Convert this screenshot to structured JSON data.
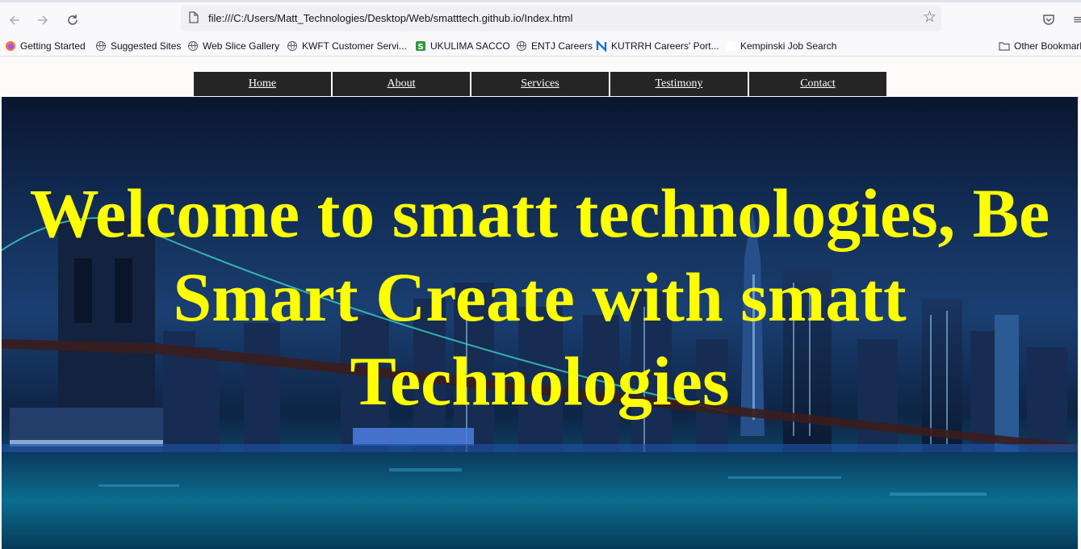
{
  "browser": {
    "url": "file:///C:/Users/Matt_Technologies/Desktop/Web/smatttech.github.io/Index.html",
    "bookmarks": [
      {
        "label": "Getting Started",
        "icon": "firefox-icon"
      },
      {
        "label": "Suggested Sites",
        "icon": "globe-icon"
      },
      {
        "label": "Web Slice Gallery",
        "icon": "globe-icon"
      },
      {
        "label": "KWFT Customer Servi...",
        "icon": "globe-icon"
      },
      {
        "label": "UKULIMA SACCO",
        "icon": "sacco-icon"
      },
      {
        "label": "ENTJ Careers",
        "icon": "globe-icon"
      },
      {
        "label": "KUTRRH Careers' Port...",
        "icon": "n-logo-icon"
      },
      {
        "label": "Kempinski Job Search",
        "icon": "blank-page-icon"
      }
    ],
    "other_bookmarks": "Other Bookmarks"
  },
  "site": {
    "nav": [
      "Home",
      "About",
      "Services",
      "Testimony",
      "Contact"
    ],
    "hero_title": "Welcome to smatt technologies, Be Smart Create with smatt Technologies",
    "colors": {
      "nav_bg": "#252525",
      "nav_text": "#ffffff",
      "hero_text": "#ffff00"
    }
  }
}
